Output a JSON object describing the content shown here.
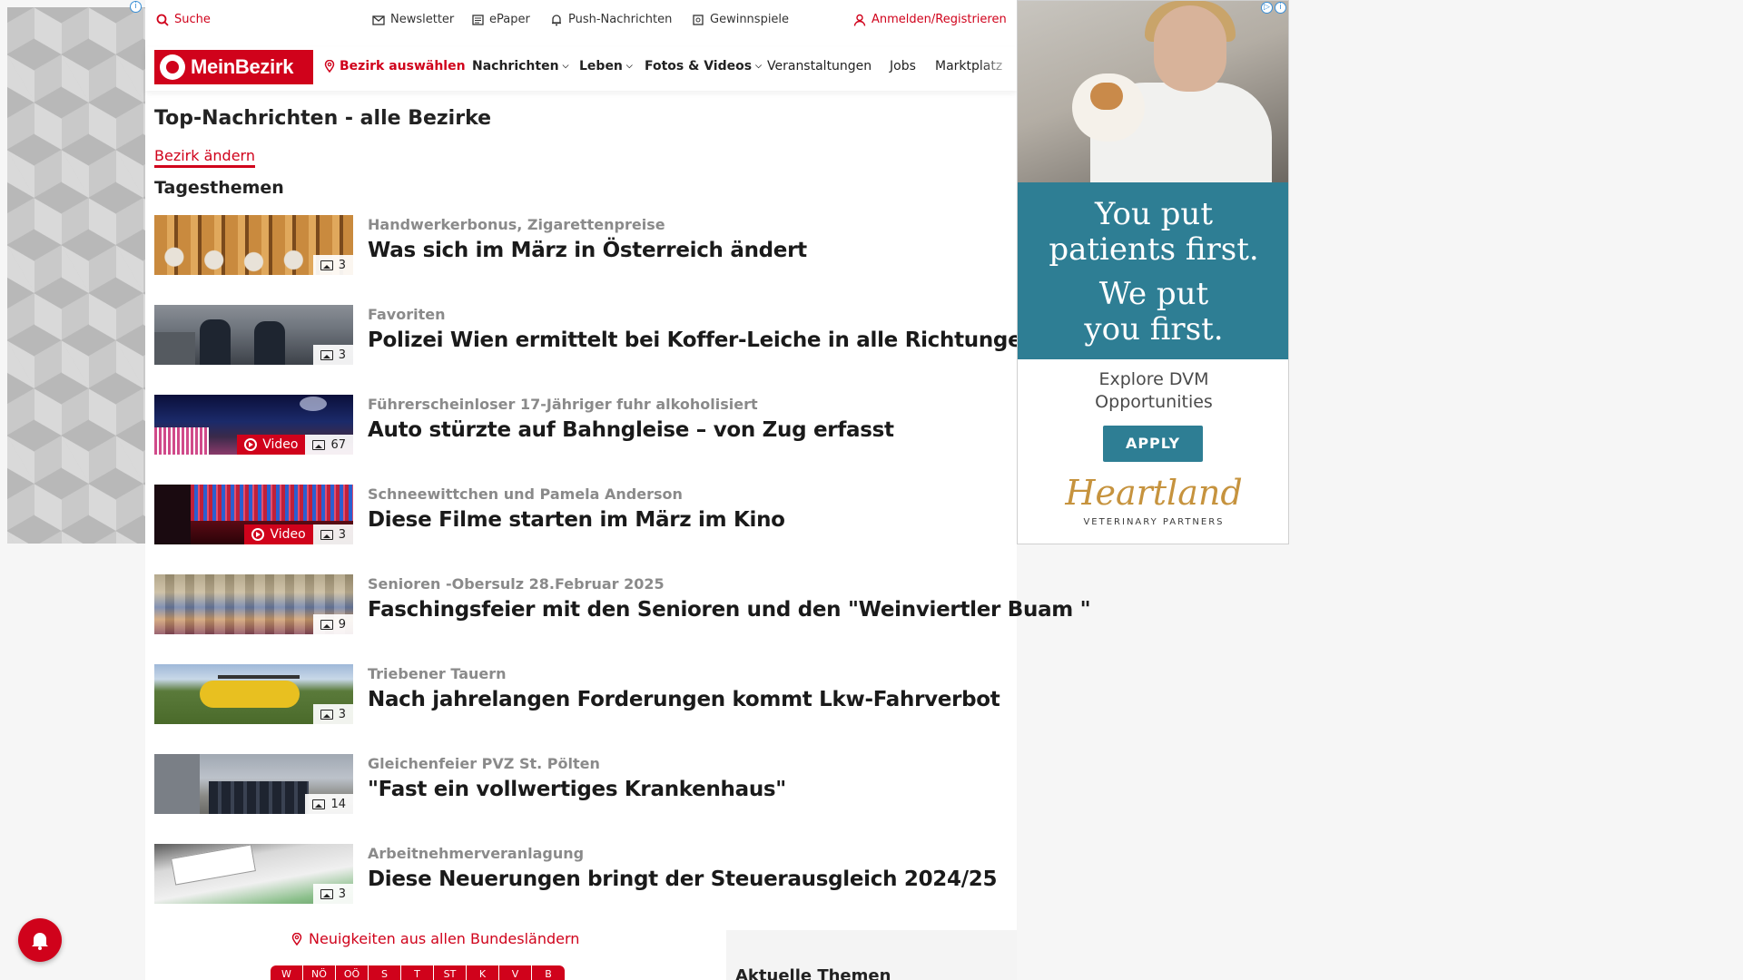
{
  "topbar": {
    "search": "Suche",
    "newsletter": "Newsletter",
    "epaper": "ePaper",
    "push": "Push-Nachrichten",
    "gewinnspiele": "Gewinnspiele",
    "login": "Anmelden/Registrieren"
  },
  "nav": {
    "logo": "MeinBezirk",
    "bezirk": "Bezirk auswählen",
    "items": [
      "Nachrichten",
      "Leben",
      "Fotos & Videos",
      "Veranstaltungen",
      "Jobs",
      "Marktplatz"
    ]
  },
  "page": {
    "title": "Top-Nachrichten - alle Bezirke",
    "change_link": "Bezirk ändern",
    "section": "Tagesthemen"
  },
  "articles": [
    {
      "kicker": "Handwerkerbonus, Zigarettenpreise",
      "headline": "Was sich im März in Österreich ändert",
      "photos": "3",
      "video": null
    },
    {
      "kicker": "Favoriten",
      "headline": "Polizei Wien ermittelt bei Koffer-Leiche in alle Richtungen",
      "photos": "3",
      "video": null
    },
    {
      "kicker": "Führerscheinloser 17-Jähriger fuhr alkoholisiert",
      "headline": "Auto stürzte auf Bahngleise – von Zug erfasst",
      "photos": "67",
      "video": "Video"
    },
    {
      "kicker": "Schneewittchen und Pamela Anderson",
      "headline": "Diese Filme starten im März im Kino",
      "photos": "3",
      "video": "Video"
    },
    {
      "kicker": "Senioren -Obersulz 28.Februar 2025",
      "headline": "Faschingsfeier mit den Senioren und den \"Weinviertler Buam \"",
      "photos": "9",
      "video": null
    },
    {
      "kicker": "Triebener Tauern",
      "headline": "Nach jahrelangen Forderungen kommt Lkw-Fahrverbot",
      "photos": "3",
      "video": null
    },
    {
      "kicker": "Gleichenfeier PVZ St. Pölten",
      "headline": "\"Fast ein vollwertiges Krankenhaus\"",
      "photos": "14",
      "video": null
    },
    {
      "kicker": "Arbeitnehmerveranlagung",
      "headline": "Diese Neuerungen bringt der Steuerausgleich 2024/25",
      "photos": "3",
      "video": null
    }
  ],
  "footer": {
    "bundeslaender": "Neuigkeiten aus allen Bundesländern",
    "states": [
      "W",
      "NÖ",
      "OÖ",
      "S",
      "T",
      "ST",
      "K",
      "V",
      "B"
    ],
    "aktuelle": "Aktuelle Themen"
  },
  "ad": {
    "line1": "You put",
    "line2": "patients first.",
    "line3": "We put",
    "line4": "you first.",
    "explore1": "Explore DVM",
    "explore2": "Opportunities",
    "apply": "APPLY",
    "brand": "Heartland",
    "brand_sub": "VETERINARY PARTNERS"
  },
  "colors": {
    "brand_red": "#d0021b",
    "ad_teal": "#2e7e94",
    "ad_gold": "#c6933e"
  }
}
